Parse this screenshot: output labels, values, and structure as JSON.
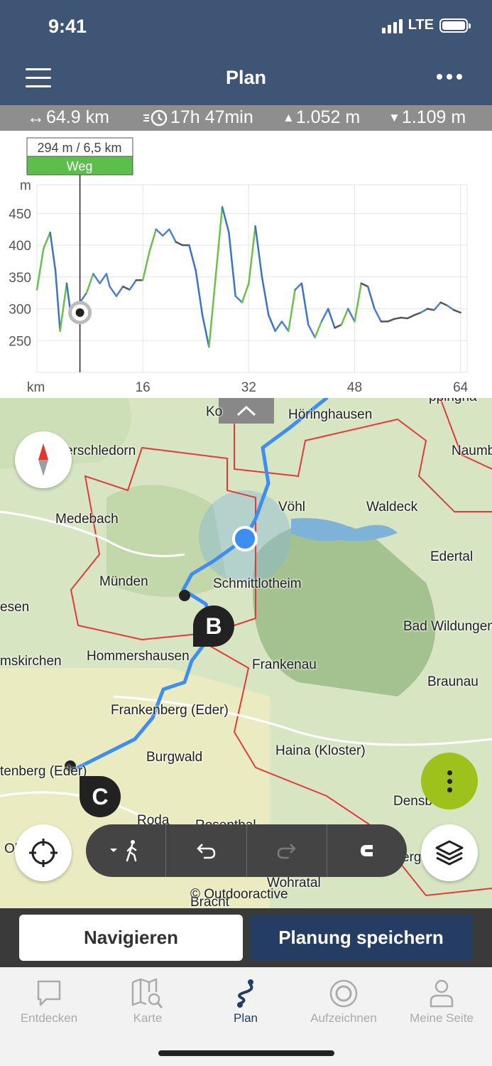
{
  "status": {
    "time": "9:41",
    "network": "LTE"
  },
  "header": {
    "title": "Plan"
  },
  "stats": {
    "distance": "64.9 km",
    "duration": "17h 47min",
    "ascent": "1.052 m",
    "descent": "1.109 m"
  },
  "profile_tooltip": {
    "value": "294 m / 6,5 km",
    "surface": "Weg"
  },
  "chart_data": {
    "type": "line",
    "xlabel": "km",
    "ylabel": "m",
    "x_ticks": [
      "16",
      "32",
      "48",
      "64"
    ],
    "y_ticks": [
      "450",
      "400",
      "350",
      "300",
      "250"
    ],
    "xlim": [
      0,
      65
    ],
    "ylim": [
      200,
      495
    ],
    "series": [
      {
        "x": [
          0,
          1,
          2,
          2.8,
          3.5,
          4.5,
          5,
          5.8,
          6.5,
          7.5,
          8.5,
          9.5,
          10.5,
          11,
          12,
          13,
          14,
          15,
          16,
          17,
          18,
          19,
          20,
          21,
          22,
          23,
          24,
          25,
          26,
          27,
          28,
          29,
          30,
          31,
          32,
          33,
          34,
          35,
          36,
          37,
          38,
          39,
          40,
          41,
          42,
          43,
          44,
          45,
          46,
          47,
          48,
          49,
          50,
          51,
          52,
          53,
          54,
          55,
          56,
          57,
          58,
          59,
          60,
          61,
          62,
          63,
          64
        ],
        "y": [
          330,
          395,
          420,
          360,
          265,
          340,
          300,
          294,
          310,
          325,
          355,
          340,
          355,
          335,
          320,
          335,
          330,
          345,
          345,
          390,
          425,
          415,
          425,
          405,
          400,
          400,
          360,
          290,
          240,
          350,
          460,
          420,
          320,
          310,
          340,
          430,
          350,
          290,
          265,
          280,
          265,
          330,
          340,
          275,
          255,
          280,
          300,
          270,
          275,
          300,
          280,
          340,
          335,
          300,
          280,
          280,
          284,
          286,
          285,
          290,
          294,
          300,
          298,
          310,
          305,
          298,
          294
        ]
      }
    ]
  },
  "map": {
    "places": [
      "Höringhausen",
      "Ko",
      "erschledorn",
      "Naumb",
      "Medebach",
      "Vöhl",
      "Waldeck",
      "Edertal",
      "Münden",
      "Schmittlotheim",
      "esen",
      "Bad Wildungen",
      "mskirchen",
      "Hommershausen",
      "Frankenau",
      "Braunau",
      "Frankenberg (Eder)",
      "Burgwald",
      "Haina (Kloster)",
      "tenberg (Eder)",
      "Densberg",
      "Roda",
      "Rosenthal",
      "Wohratal",
      "Bracht",
      "Ob",
      "erg",
      "ppingha"
    ],
    "markers": [
      "B",
      "C"
    ],
    "attribution": "© Outdooractive"
  },
  "actions": {
    "navigate": "Navigieren",
    "save": "Planung speichern"
  },
  "tabs": [
    "Entdecken",
    "Karte",
    "Plan",
    "Aufzeichnen",
    "Meine Seite"
  ],
  "colors": {
    "header": "#3f5575",
    "accent": "#263d63",
    "route": "#3d8ef0",
    "lime": "#9dc21c"
  }
}
